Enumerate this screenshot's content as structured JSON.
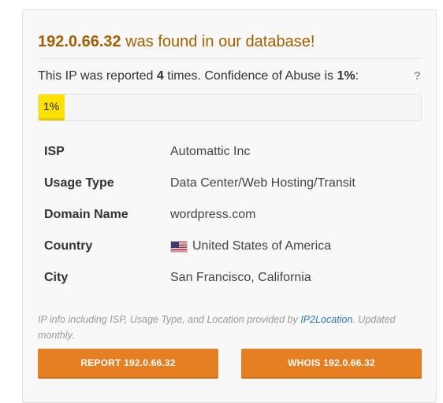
{
  "headline": {
    "ip": "192.0.66.32",
    "suffix": " was found in our database!"
  },
  "report_summary": {
    "prefix": "This IP was reported ",
    "count": "4",
    "middle": " times. Confidence of Abuse is ",
    "confidence": "1%",
    "suffix": ":",
    "help_label": "?"
  },
  "abuse_confidence": {
    "percent": 1,
    "label": "1%",
    "fill_color": "#ffe100"
  },
  "ip_info": [
    {
      "key": "ISP",
      "value": "Automattic Inc"
    },
    {
      "key": "Usage Type",
      "value": "Data Center/Web Hosting/Transit"
    },
    {
      "key": "Domain Name",
      "value": "wordpress.com"
    },
    {
      "key": "Country",
      "value": "United States of America",
      "icon": "us-flag-icon"
    },
    {
      "key": "City",
      "value": "San Francisco, California"
    }
  ],
  "note": {
    "text": "IP info including ISP, Usage Type, and Location provided by ",
    "link": "IP2Location",
    "after": ". Updated monthly."
  },
  "buttons": {
    "report": "REPORT 192.0.66.32",
    "whois": "WHOIS 192.0.66.32"
  },
  "colors": {
    "headline": "#a06000",
    "button": "#e67e22",
    "link": "#2b7bb9"
  }
}
